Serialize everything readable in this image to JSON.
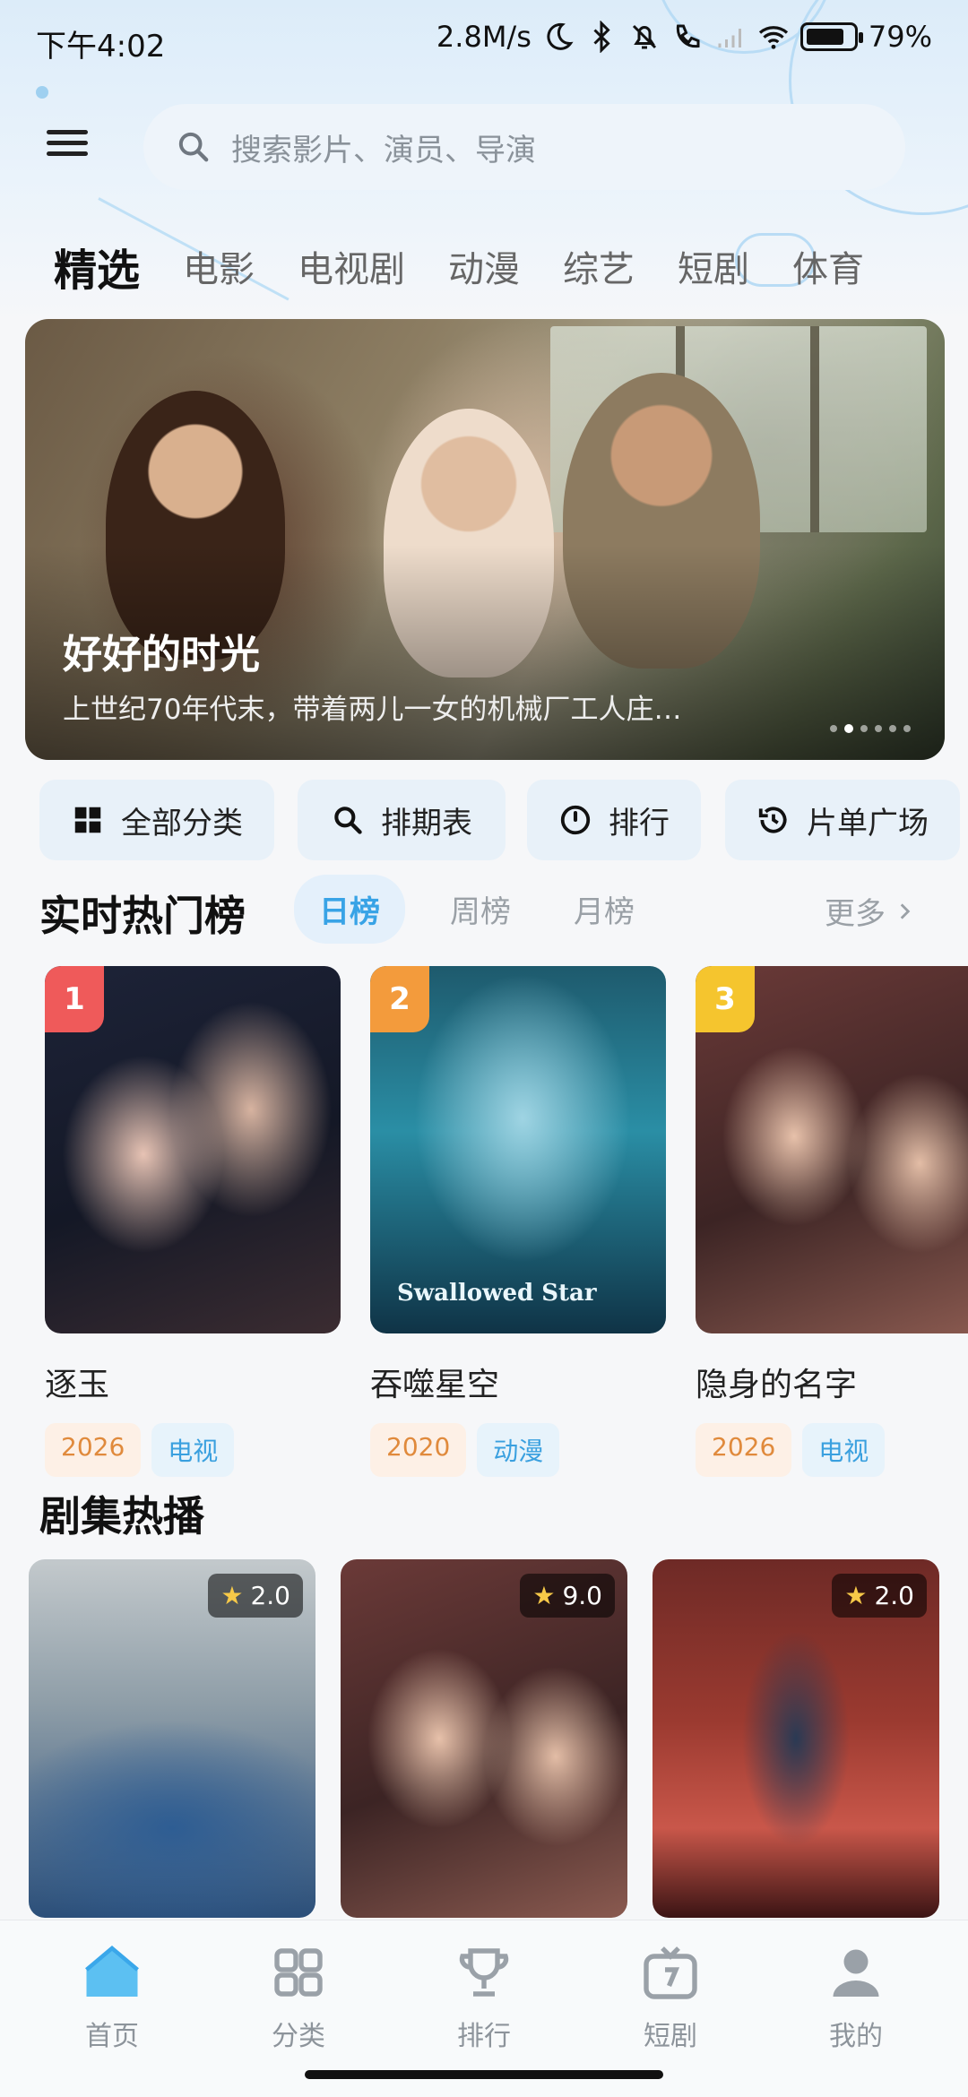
{
  "status_bar": {
    "time": "下午4:02",
    "net_speed": "2.8M/s",
    "battery": "79%",
    "battery_level": 0.79
  },
  "search": {
    "placeholder": "搜索影片、演员、导演"
  },
  "top_tabs": [
    "精选",
    "电影",
    "电视剧",
    "动漫",
    "综艺",
    "短剧",
    "体育"
  ],
  "active_top_tab": 0,
  "banner": {
    "title": "好好的时光",
    "description": "上世纪70年代末，带着两儿一女的机械厂工人庄…",
    "page_count": 6,
    "active_page": 1
  },
  "quick_buttons": [
    {
      "label": "全部分类",
      "icon": "grid-icon"
    },
    {
      "label": "排期表",
      "icon": "search-icon"
    },
    {
      "label": "排行",
      "icon": "rank-icon"
    },
    {
      "label": "片单广场",
      "icon": "history-icon"
    }
  ],
  "hot_ranking": {
    "title": "实时热门榜",
    "tabs": [
      "日榜",
      "周榜",
      "月榜"
    ],
    "active_tab": 0,
    "more_label": "更多",
    "items": [
      {
        "rank": "1",
        "name": "逐玉",
        "year": "2026",
        "type": "电视",
        "badge_color": "#ef5a5a"
      },
      {
        "rank": "2",
        "name": "吞噬星空",
        "year": "2020",
        "type": "动漫",
        "badge_color": "#f39b3c"
      },
      {
        "rank": "3",
        "name": "隐身的名字",
        "year": "2026",
        "type": "电视",
        "badge_color": "#f5c52e"
      }
    ]
  },
  "drama_section": {
    "title": "剧集热播",
    "items": [
      {
        "score": "2.0"
      },
      {
        "score": "9.0"
      },
      {
        "score": "2.0"
      }
    ]
  },
  "bottom_nav": [
    {
      "label": "首页",
      "icon": "home-icon"
    },
    {
      "label": "分类",
      "icon": "category-icon"
    },
    {
      "label": "排行",
      "icon": "trophy-icon"
    },
    {
      "label": "短剧",
      "icon": "tv-icon"
    },
    {
      "label": "我的",
      "icon": "user-icon"
    }
  ],
  "active_nav": 0,
  "colors": {
    "accent": "#2f9be6",
    "year_tag": "#e08a3c",
    "type_tag": "#3aa0df"
  }
}
